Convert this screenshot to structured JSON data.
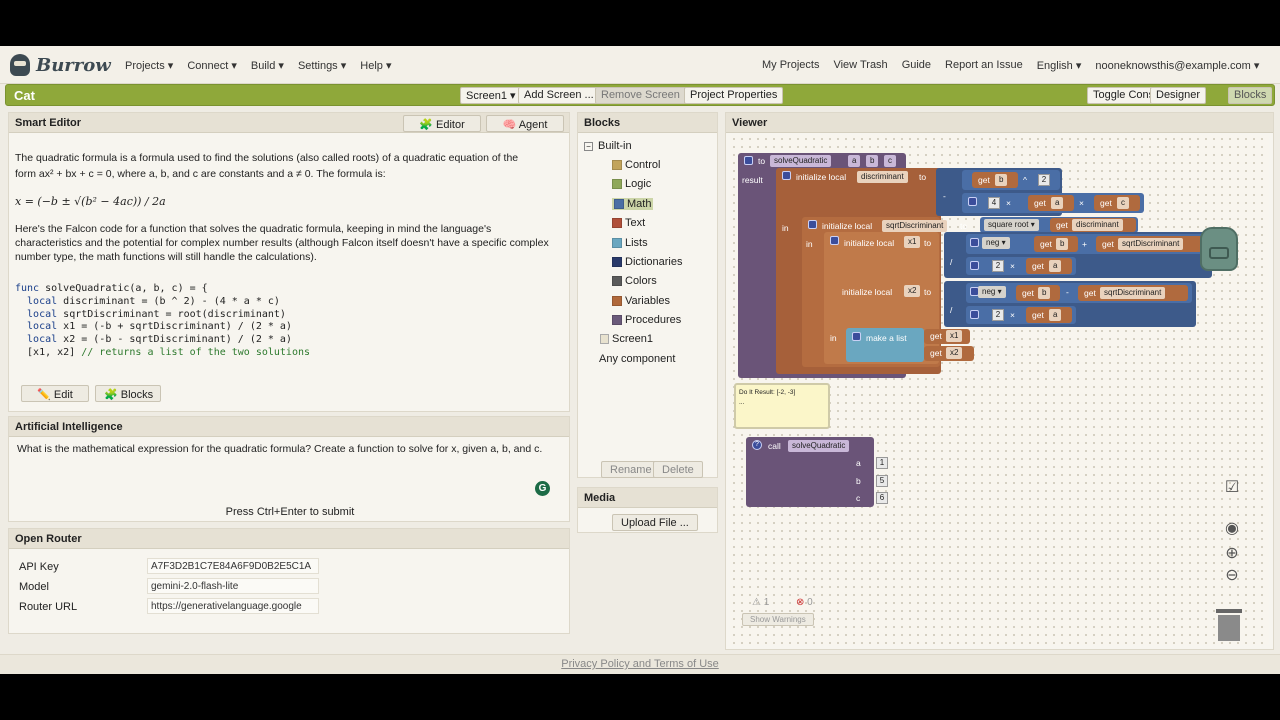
{
  "app": {
    "name": "Burrow",
    "project": "Cat"
  },
  "nav": {
    "left": [
      "Projects ▾",
      "Connect ▾",
      "Build ▾",
      "Settings ▾",
      "Help ▾"
    ],
    "right": [
      "My Projects",
      "View Trash",
      "Guide",
      "Report an Issue",
      "English ▾",
      "nooneknowsthis@example.com ▾"
    ]
  },
  "toolbar": {
    "screen": "Screen1 ▾",
    "add_screen": "Add Screen ...",
    "remove_screen": "Remove Screen",
    "project_properties": "Project Properties",
    "toggle_console": "Toggle Console",
    "designer": "Designer",
    "blocks": "Blocks"
  },
  "smart_editor": {
    "title": "Smart Editor",
    "tab_editor": "🧩 Editor",
    "tab_agent": "🧠 Agent",
    "p1a": "The quadratic formula is a formula used to find the solutions (also called roots) of a quadratic equation of the",
    "p1b": "form ax² + bx + c = 0, where a, b, and c are constants and a ≠ 0. The formula is:",
    "formula": "x = (−b ± √(b² − 4ac)) / 2a",
    "p2": "Here's the Falcon code for a function that solves the quadratic formula, keeping in mind the language's characteristics and the potential for complex number results (although Falcon itself doesn't have a specific complex number type, the math functions will still handle the calculations).",
    "code": [
      {
        "kw": "func",
        "rest": " solveQuadratic(a, b, c) = {"
      },
      {
        "kw": "  local",
        "rest": " discriminant = (b ^ 2) - (4 * a * c)"
      },
      {
        "kw": "  local",
        "rest": " sqrtDiscriminant = root(discriminant)"
      },
      {
        "kw": "  local",
        "rest": " x1 = (-b + sqrtDiscriminant) / (2 * a)"
      },
      {
        "kw": "  local",
        "rest": " x2 = (-b - sqrtDiscriminant) / (2 * a)"
      },
      {
        "kw": "  [x1, x2]",
        "rest": " // returns a list of the two solutions"
      }
    ],
    "edit_btn": "✏️ Edit",
    "blocks_btn": "🧩 Blocks"
  },
  "ai": {
    "title": "Artificial Intelligence",
    "prompt": "What is the mathematical expression for the quadratic formula? Create a function to solve for x, given a, b, and c.",
    "hint": "Press Ctrl+Enter to submit"
  },
  "router": {
    "title": "Open Router",
    "api_key_label": "API Key",
    "api_key": "A7F3D2B1C7E84A6F9D0B2E5C1A",
    "model_label": "Model",
    "model": "gemini-2.0-flash-lite",
    "url_label": "Router URL",
    "url": "https://generativelanguage.google"
  },
  "blocks_panel": {
    "title": "Blocks",
    "builtin": "Built-in",
    "categories": [
      {
        "name": "Control",
        "color": "#c2a45c"
      },
      {
        "name": "Logic",
        "color": "#8fa85a"
      },
      {
        "name": "Math",
        "color": "#4a6fa5"
      },
      {
        "name": "Text",
        "color": "#b0503a"
      },
      {
        "name": "Lists",
        "color": "#6aa7c0"
      },
      {
        "name": "Dictionaries",
        "color": "#2a3a6a"
      },
      {
        "name": "Colors",
        "color": "#5a5a5a"
      },
      {
        "name": "Variables",
        "color": "#b0683a"
      },
      {
        "name": "Procedures",
        "color": "#6a5a7a"
      }
    ],
    "screen": "Screen1",
    "any_component": "Any component",
    "rename": "Rename",
    "delete": "Delete"
  },
  "media": {
    "title": "Media",
    "upload": "Upload File ..."
  },
  "viewer": {
    "title": "Viewer",
    "proc_to": "to",
    "proc_name": "solveQuadratic",
    "params": [
      "a",
      "b",
      "c"
    ],
    "result": "result",
    "init_local": "initialize local",
    "to": "to",
    "in": "in",
    "var_disc": "discriminant",
    "var_sqrt": "sqrtDiscriminant",
    "var_x1": "x1",
    "var_x2": "x2",
    "get": "get",
    "sqrt_fn": "square root ▾",
    "neg_fn": "neg ▾",
    "make_list": "make a list",
    "pow": "^",
    "minus": "-",
    "times": "×",
    "plus": "+",
    "div": "/",
    "n2": "2",
    "n4": "4",
    "do_it": "Do It Result: [-2, -3]",
    "do_it_sub": "...",
    "call": "call",
    "call_args": [
      {
        "name": "a",
        "val": "1"
      },
      {
        "name": "b",
        "val": "5"
      },
      {
        "name": "c",
        "val": "6"
      }
    ],
    "warn_count": "1",
    "err_count": "0",
    "show_warnings": "Show Warnings"
  },
  "footer": "Privacy Policy and Terms of Use"
}
